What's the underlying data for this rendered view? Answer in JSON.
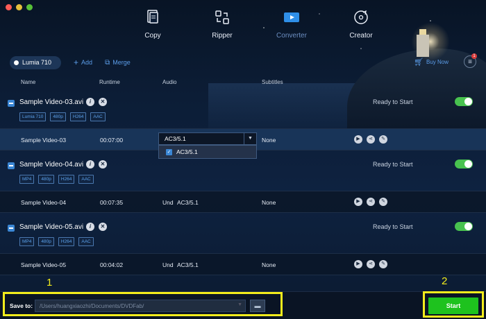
{
  "window": {
    "controls": [
      "close",
      "minimize",
      "zoom"
    ],
    "colors": {
      "close": "#fc5b57",
      "minimize": "#e5bf3c",
      "zoom": "#57c038"
    }
  },
  "nav": [
    {
      "label": "Copy",
      "icon": "copy-icon",
      "active": false
    },
    {
      "label": "Ripper",
      "icon": "ripper-icon",
      "active": false
    },
    {
      "label": "Converter",
      "icon": "converter-icon",
      "active": true
    },
    {
      "label": "Creator",
      "icon": "creator-icon",
      "active": false
    }
  ],
  "toolbar": {
    "device": "Lumia 710",
    "add": "Add",
    "merge": "Merge",
    "buy_now": "Buy Now",
    "menu_badge": "1"
  },
  "columns": {
    "name": "Name",
    "runtime": "Runtime",
    "audio": "Audio",
    "subtitles": "Subtitles"
  },
  "titles": [
    {
      "file": "Sample Video-03.avi",
      "tags": [
        "Lumia 710",
        "480p",
        "H264",
        "AAC"
      ],
      "status": "Ready to Start",
      "enabled": true,
      "row": {
        "name": "Sample Video-03",
        "runtime": "00:07:00",
        "audio": "AC3/5.1",
        "subtitles": "None",
        "selected": true
      }
    },
    {
      "file": "Sample Video-04.avi",
      "tags": [
        "MP4",
        "480p",
        "H264",
        "AAC"
      ],
      "status": "Ready to Start",
      "enabled": true,
      "row": {
        "name": "Sample Video-04",
        "runtime": "00:07:35",
        "audio_lang": "Und",
        "audio": "AC3/5.1",
        "subtitles": "None",
        "selected": false
      }
    },
    {
      "file": "Sample Video-05.avi",
      "tags": [
        "MP4",
        "480p",
        "H264",
        "AAC"
      ],
      "status": "Ready to Start",
      "enabled": true,
      "row": {
        "name": "Sample Video-05",
        "runtime": "00:04:02",
        "audio_lang": "Und",
        "audio": "AC3/5.1",
        "subtitles": "None",
        "selected": false
      }
    }
  ],
  "audio_dropdown": {
    "selected": "AC3/5.1",
    "options": [
      "AC3/5.1"
    ]
  },
  "save": {
    "label": "Save to:",
    "path": "/Users/huangxiaozhi/Documents/DVDFab/"
  },
  "start": {
    "label": "Start"
  },
  "callouts": {
    "one": "1",
    "two": "2"
  },
  "highlight_color": "#f3ec1c",
  "accent_color": "#3a86d4",
  "start_color": "#1ec21e"
}
